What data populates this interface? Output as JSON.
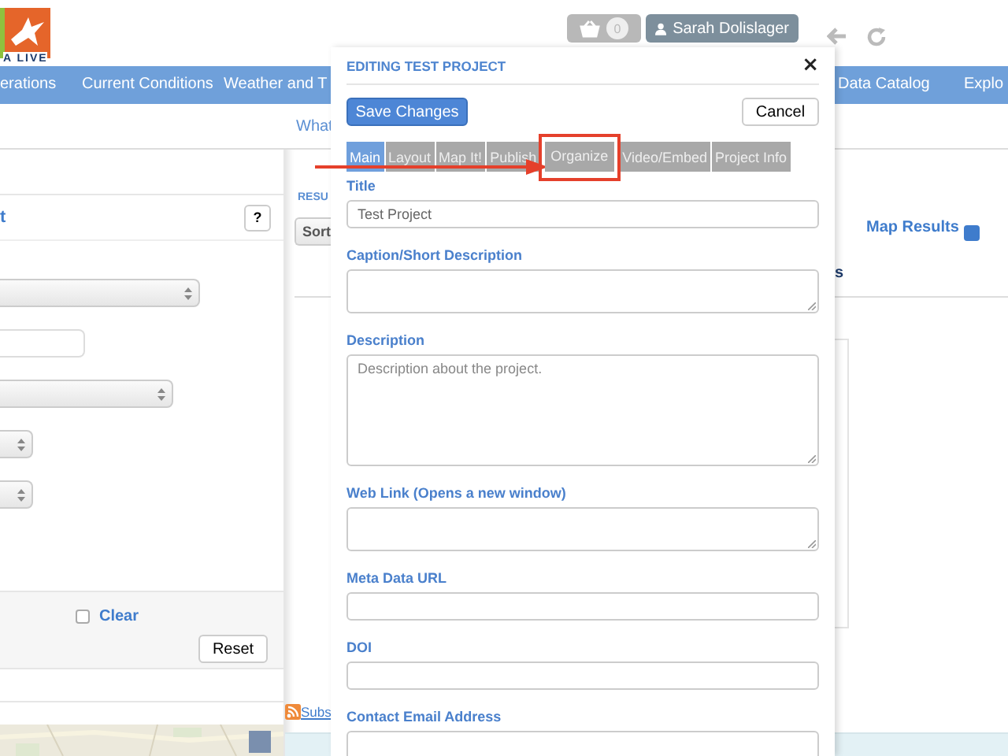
{
  "header": {
    "logo_text": "A LIVE",
    "cart_count": "0",
    "user": "Sarah Dolislager"
  },
  "nav": {
    "items": [
      "erations",
      "Current Conditions",
      "Weather and T",
      "Data Catalog",
      "Explo"
    ]
  },
  "subnav": {
    "link": "What"
  },
  "filter_panel": {
    "title": "t",
    "help": "?",
    "controls": [
      {
        "kind": "select"
      },
      {
        "kind": "input"
      },
      {
        "kind": "select"
      },
      {
        "kind": "select"
      },
      {
        "kind": "select"
      }
    ],
    "clear": {
      "label": "Clear",
      "checked": false
    },
    "reset": "Reset"
  },
  "results": {
    "heading": "RESU",
    "sort": "Sort",
    "map_results": {
      "label": "Map Results",
      "checked": true
    },
    "column_fragment": "s",
    "subscribe": "Subs"
  },
  "modal": {
    "title": "EDITING TEST PROJECT",
    "close": "×",
    "save": "Save Changes",
    "cancel": "Cancel",
    "tabs": [
      {
        "label": "Main",
        "selected": true,
        "highlighted": false
      },
      {
        "label": "Layout",
        "selected": false,
        "highlighted": false
      },
      {
        "label": "Map It!",
        "selected": false,
        "highlighted": false
      },
      {
        "label": "Publish",
        "selected": false,
        "highlighted": false
      },
      {
        "label": "Organize",
        "selected": false,
        "highlighted": true
      },
      {
        "label": "Video/Embed",
        "selected": false,
        "highlighted": false
      },
      {
        "label": "Project Info",
        "selected": false,
        "highlighted": false
      }
    ],
    "fields": [
      {
        "label": "Title",
        "kind": "input",
        "value": "Test Project"
      },
      {
        "label": "Caption/Short Description",
        "kind": "textarea"
      },
      {
        "label": "Description",
        "kind": "textarea",
        "placeholder": "Description about the project."
      },
      {
        "label": "Web Link (Opens a new window)",
        "kind": "textarea"
      },
      {
        "label": "Meta Data URL",
        "kind": "input"
      },
      {
        "label": "DOI",
        "kind": "input"
      },
      {
        "label": "Contact Email Address",
        "kind": "textarea"
      }
    ]
  }
}
